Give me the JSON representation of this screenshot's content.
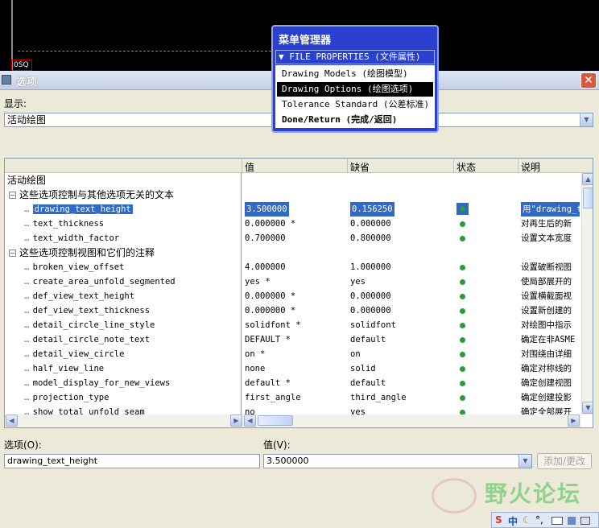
{
  "graphics": {
    "corner_label": "0SQ"
  },
  "dialog": {
    "title": "选项",
    "close_label": "✕",
    "display_label": "显示:",
    "display_value": "活动绘图"
  },
  "table": {
    "headers": {
      "value": "值",
      "default": "缺省",
      "status": "状态",
      "description": "说明"
    },
    "root": "活动绘图",
    "groups": [
      {
        "label": "这些选项控制与其他选项无关的文本"
      },
      {
        "label": "这些选项控制视图和它们的注释"
      }
    ],
    "rows": [
      {
        "name": "drawing_text_height",
        "value": "3.500000",
        "default": "0.156250",
        "desc": "用\"drawing_t"
      },
      {
        "name": "text_thickness",
        "value": "0.000000 *",
        "default": "0.000000",
        "desc": "对再生后的新"
      },
      {
        "name": "text_width_factor",
        "value": "0.700000",
        "default": "0.800000",
        "desc": "设置文本宽度"
      },
      {
        "name": "broken_view_offset",
        "value": "4.000000",
        "default": "1.000000",
        "desc": "设置破断视图"
      },
      {
        "name": "create_area_unfold_segmented",
        "value": "yes *",
        "default": "yes",
        "desc": "使局部展开的"
      },
      {
        "name": "def_view_text_height",
        "value": "0.000000 *",
        "default": "0.000000",
        "desc": "设置横截面视"
      },
      {
        "name": "def_view_text_thickness",
        "value": "0.000000 *",
        "default": "0.000000",
        "desc": "设置新创建的"
      },
      {
        "name": "detail_circle_line_style",
        "value": "solidfont *",
        "default": "solidfont",
        "desc": "对绘图中指示"
      },
      {
        "name": "detail_circle_note_text",
        "value": "DEFAULT *",
        "default": "default",
        "desc": "确定在非ASME"
      },
      {
        "name": "detail_view_circle",
        "value": "on *",
        "default": "on",
        "desc": "对围绕由详细"
      },
      {
        "name": "half_view_line",
        "value": "none",
        "default": "solid",
        "desc": "确定对称线的"
      },
      {
        "name": "model_display_for_new_views",
        "value": "default *",
        "default": "default",
        "desc": "确定创建视图"
      },
      {
        "name": "projection_type",
        "value": "first_angle",
        "default": "third_angle",
        "desc": "确定创建投影"
      },
      {
        "name": "show_total_unfold_seam",
        "value": "no",
        "default": "yes",
        "desc": "确定全部展开"
      }
    ]
  },
  "footer": {
    "option_label": "选项(O):",
    "option_value": "drawing_text_height",
    "value_label": "值(V):",
    "value_value": "3.500000",
    "apply_label": "添加/更改"
  },
  "watermark": {
    "text": "野火论坛"
  },
  "ime": {
    "s": "S",
    "zh": "中",
    "moon": "☾",
    "dot": "°,"
  },
  "menu": {
    "title": "菜单管理器",
    "header": "FILE PROPERTIES (文件属性)",
    "items": [
      {
        "label": "Drawing Models (绘图模型)"
      },
      {
        "label": "Drawing Options (绘图选项)"
      },
      {
        "label": "Tolerance Standard (公差标准)"
      },
      {
        "label": "Done/Return (完成/返回)"
      }
    ]
  }
}
